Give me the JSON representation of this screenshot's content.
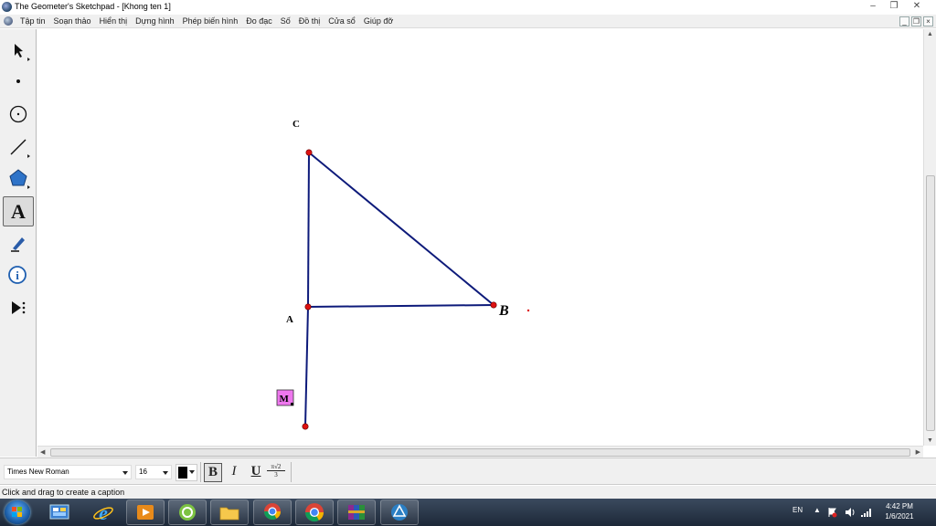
{
  "window": {
    "title": "The Geometer's Sketchpad - [Khong ten 1]",
    "controls": [
      "–",
      "❐",
      "✕"
    ]
  },
  "menu": {
    "items": [
      "Tập tin",
      "Soạn thảo",
      "Hiển thị",
      "Dựng hình",
      "Phép biến hình",
      "Đo đạc",
      "Số",
      "Đồ thị",
      "Cửa sổ",
      "Giúp đỡ"
    ],
    "doc_controls": [
      "_",
      "❐",
      "×"
    ]
  },
  "toolbox": {
    "tools": [
      "selection-arrow",
      "point",
      "compass",
      "straightedge",
      "polygon",
      "text",
      "marker",
      "information",
      "custom-tools"
    ],
    "active": "text",
    "text_tool_glyph": "A"
  },
  "sketch": {
    "points": [
      {
        "name": "C",
        "label": "C",
        "style": "bold"
      },
      {
        "name": "A",
        "label": "A",
        "style": "bold"
      },
      {
        "name": "B",
        "label": "B",
        "style": "bold-italic"
      },
      {
        "name": "M",
        "label": "M",
        "style": "bold-highlighted"
      }
    ],
    "colors": {
      "segment": "#0d1a7a",
      "point": "#dd1111",
      "label_highlight": "#ee77ee"
    }
  },
  "textbar": {
    "font_name": "Times New Roman",
    "font_size": "16",
    "color_value": "#000000",
    "bold": "B",
    "italic": "I",
    "underline": "U",
    "math_numerator": "π√2",
    "math_denominator": "3"
  },
  "status": {
    "message": "Click and drag to create a caption"
  },
  "taskbar": {
    "apps": [
      "start",
      "control-panel",
      "internet-explorer",
      "media-player",
      "app-green",
      "file-explorer",
      "chrome-beta",
      "chrome",
      "winrar",
      "sketchpad"
    ],
    "lang": "EN",
    "time": "4:42 PM",
    "date": "1/6/2021"
  }
}
